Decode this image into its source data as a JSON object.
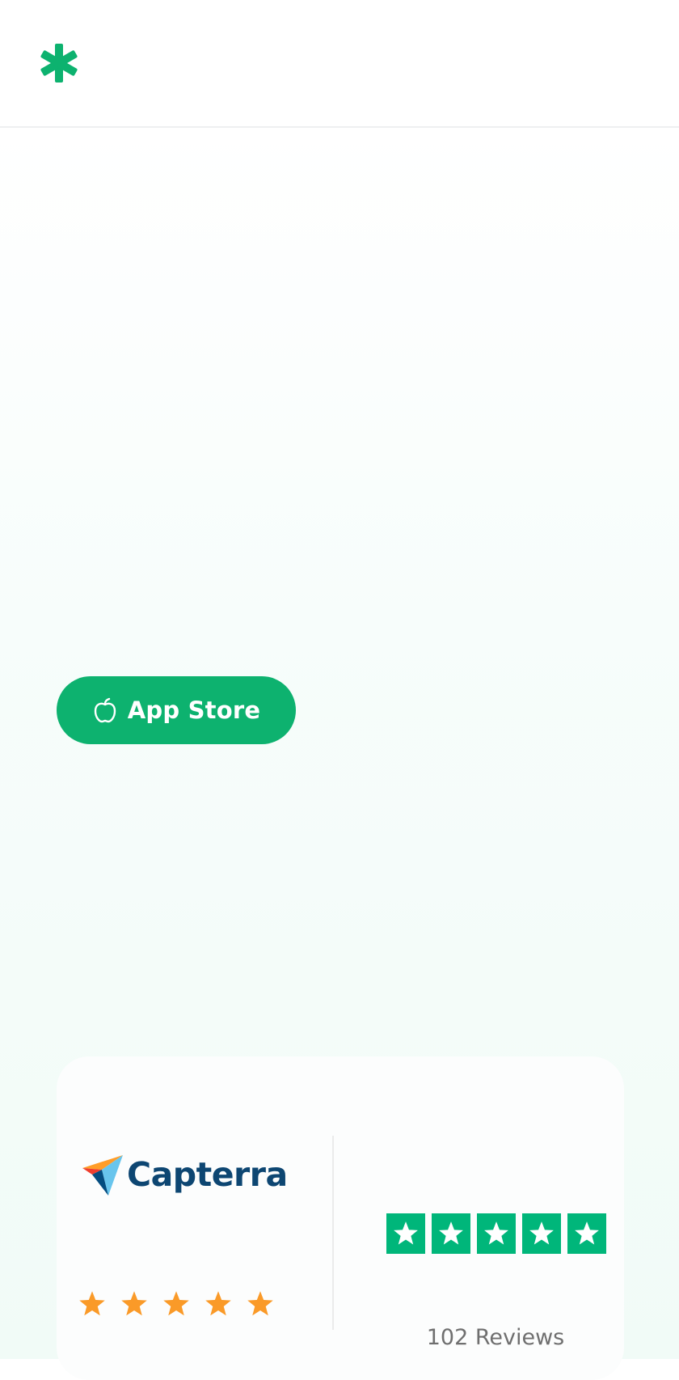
{
  "header": {
    "logo_icon": "asterisk-logo-icon"
  },
  "hero": {
    "app_store_button": {
      "icon": "apple-icon",
      "label": "App Store"
    }
  },
  "ratings": {
    "capterra": {
      "name": "Capterra",
      "stars": 5,
      "star_color": "#fa9a28"
    },
    "trustpilot": {
      "stars": 5,
      "star_box_color": "#00b67a",
      "reviews_label": "102 Reviews"
    }
  },
  "colors": {
    "brand_green": "#0db26f",
    "capterra_blue": "#0d4672"
  }
}
